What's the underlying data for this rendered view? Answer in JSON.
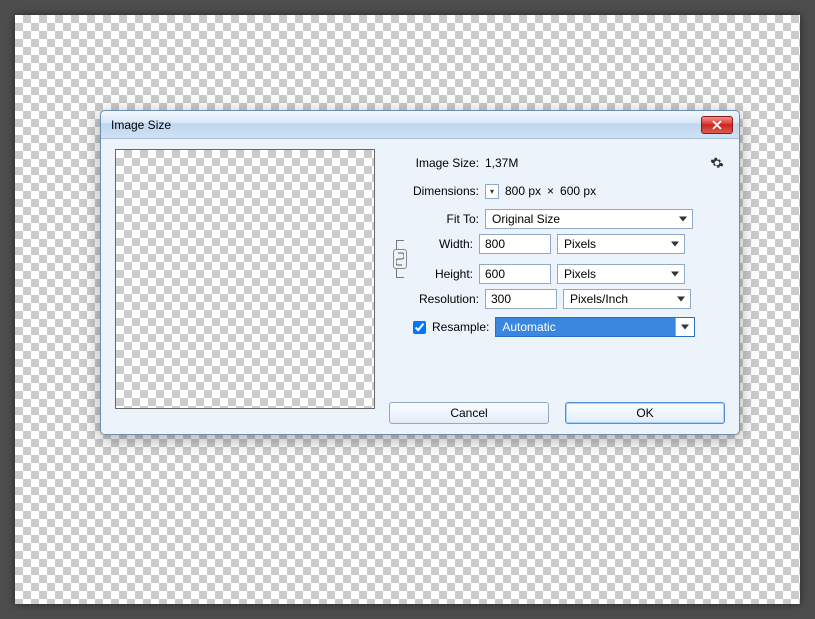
{
  "dialog": {
    "title": "Image Size",
    "labels": {
      "image_size": "Image Size:",
      "dimensions": "Dimensions:",
      "fit_to": "Fit To:",
      "width": "Width:",
      "height": "Height:",
      "resolution": "Resolution:",
      "resample": "Resample:"
    },
    "values": {
      "image_size": "1,37M",
      "dim_w": "800 px",
      "dim_sep": "×",
      "dim_h": "600 px",
      "fit_to": "Original Size",
      "width": "800",
      "width_unit": "Pixels",
      "height": "600",
      "height_unit": "Pixels",
      "resolution": "300",
      "resolution_unit": "Pixels/Inch",
      "resample_checked": true,
      "resample_mode": "Automatic"
    },
    "buttons": {
      "cancel": "Cancel",
      "ok": "OK"
    }
  }
}
